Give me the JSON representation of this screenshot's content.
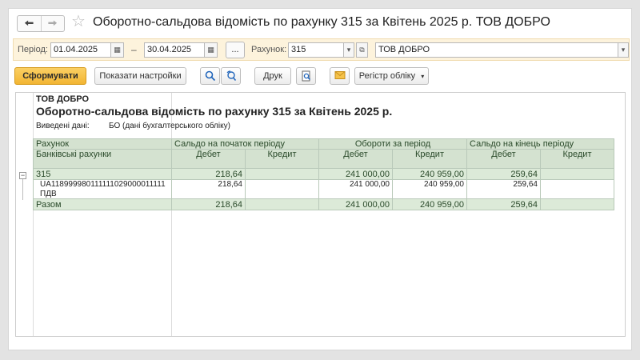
{
  "window": {
    "title": "Оборотно-сальдова відомість по рахунку 315 за Квітень 2025 р. ТОВ ДОБРО",
    "back_icon": "arrow-left-icon",
    "forward_icon": "arrow-right-icon",
    "favorite_icon": "star-icon"
  },
  "params": {
    "period_label": "Період:",
    "date_from": "01.04.2025",
    "dash": "–",
    "date_to": "30.04.2025",
    "more_label": "...",
    "account_label": "Рахунок:",
    "account_value": "315",
    "organization_value": "ТОВ ДОБРО"
  },
  "toolbar": {
    "generate_label": "Сформувати",
    "settings_label": "Показати настройки",
    "print_label": "Друк",
    "register_label": "Регістр обліку"
  },
  "report": {
    "organization": "ТОВ ДОБРО",
    "heading": "Оборотно-сальдова відомість по рахунку 315 за Квітень 2025 р.",
    "data_label": "Виведені дані:",
    "data_value": "БО (дані бухгалтерського обліку)",
    "header": {
      "account": "Рахунок",
      "subaccount": "Банківські рахунки",
      "opening": "Сальдо на початок періоду",
      "turnover": "Обороти за період",
      "closing": "Сальдо на кінець періоду",
      "debit": "Дебет",
      "credit": "Кредит"
    },
    "group": {
      "name": "315",
      "open_debit": "218,64",
      "open_credit": "",
      "turn_debit": "241 000,00",
      "turn_credit": "240 959,00",
      "close_debit": "259,64",
      "close_credit": ""
    },
    "detail": {
      "name": "UA118999980111111029000011111",
      "name2": "ПДВ",
      "open_debit": "218,64",
      "open_credit": "",
      "turn_debit": "241 000,00",
      "turn_credit": "240 959,00",
      "close_debit": "259,64",
      "close_credit": ""
    },
    "total": {
      "name": "Разом",
      "open_debit": "218,64",
      "open_credit": "",
      "turn_debit": "241 000,00",
      "turn_credit": "240 959,00",
      "close_debit": "259,64",
      "close_credit": ""
    }
  }
}
